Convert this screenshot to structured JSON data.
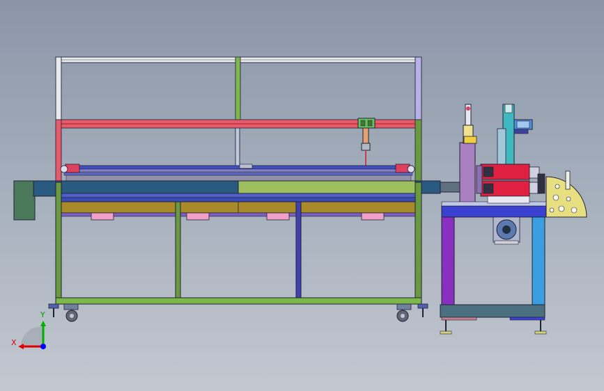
{
  "axis_triad": {
    "x_label": "X",
    "y_label": "Y",
    "x_color": "#e00000",
    "y_color": "#00b000",
    "z_color": "#0000ff"
  },
  "colors": {
    "background_top": "#8a96a8",
    "background_bottom": "#c3c8d0",
    "frame_white": "#e8eaec",
    "frame_red": "#e85a6a",
    "frame_green": "#7db84a",
    "frame_purple": "#8a7ad0",
    "conveyor_blue": "#2a5a80",
    "conveyor_green": "#9cc060",
    "conveyor_gold": "#a88a2a",
    "motor_red": "#e02040",
    "stand_blue": "#3a40d0",
    "stand_purple": "#8a30c0",
    "stand_cyan": "#3a9ee0",
    "disc_yellow": "#e8df80",
    "pink_bracket": "#f0a0c8"
  }
}
